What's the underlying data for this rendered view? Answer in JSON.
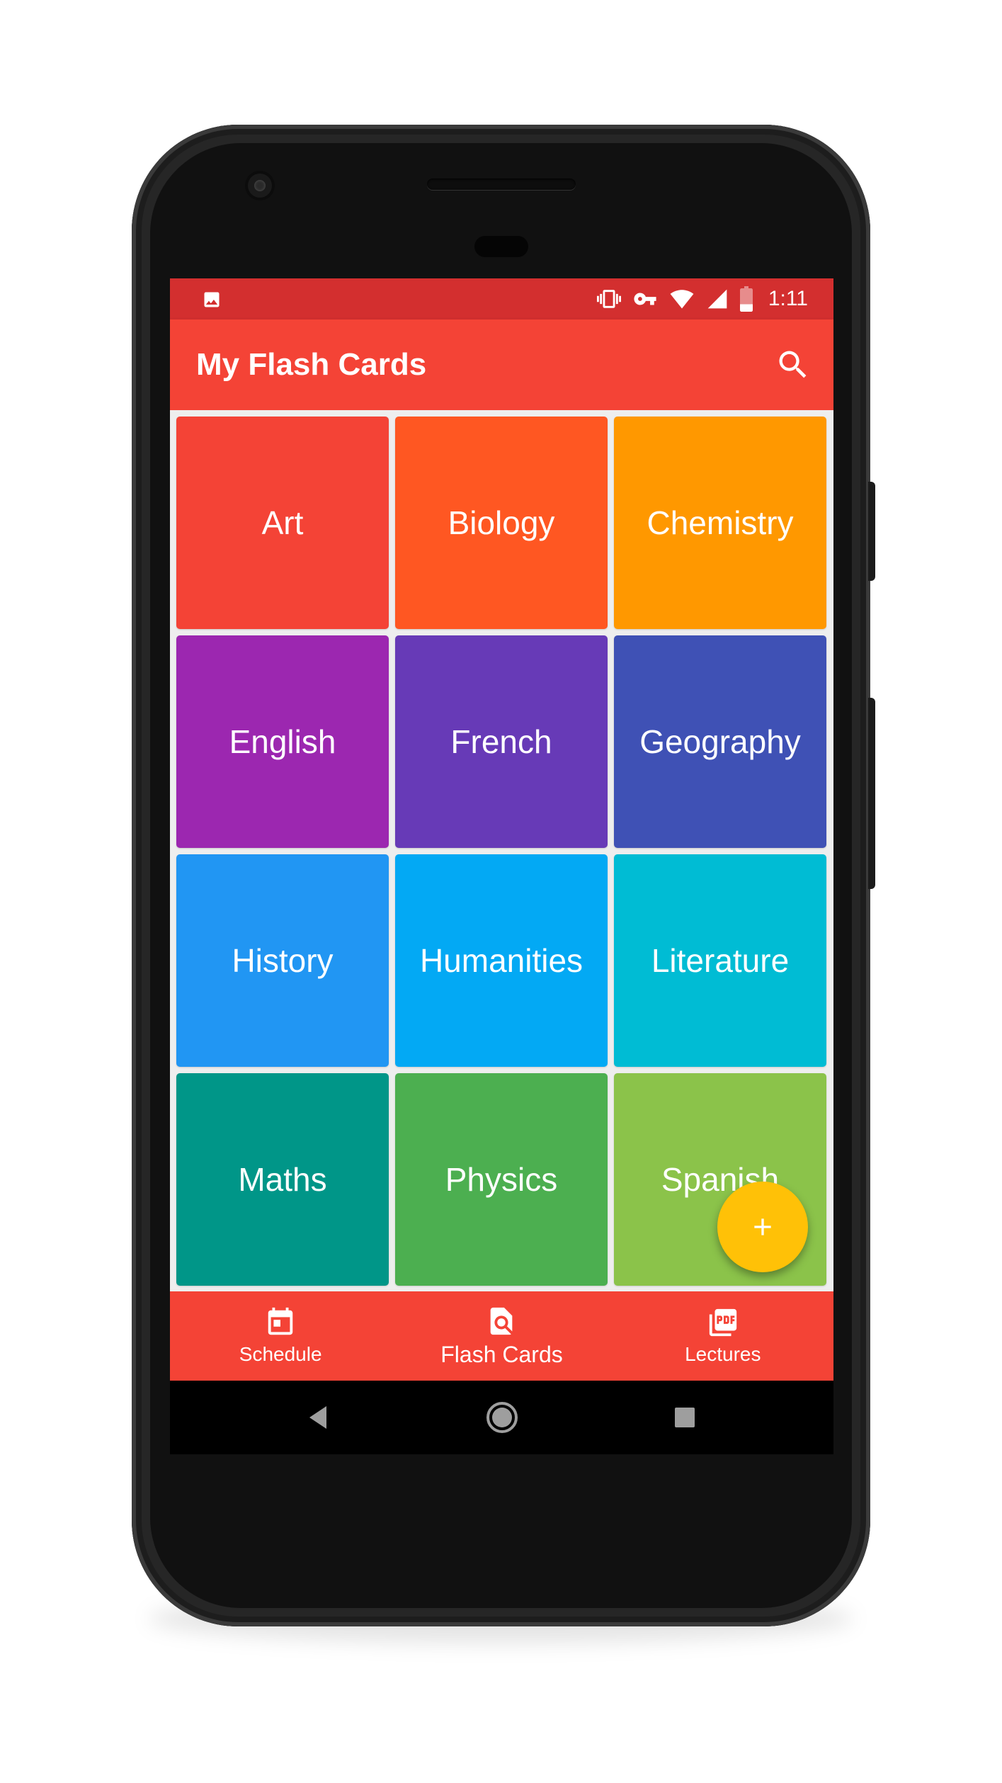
{
  "status_bar": {
    "time": "1:11",
    "icons": [
      "image-icon",
      "vibrate-icon",
      "vpn-key-icon",
      "wifi-icon",
      "signal-icon",
      "battery-icon"
    ]
  },
  "app_bar": {
    "title": "My Flash Cards",
    "search_icon": "search-icon"
  },
  "subjects": [
    {
      "label": "Art",
      "color": "#f44336"
    },
    {
      "label": "Biology",
      "color": "#ff5722"
    },
    {
      "label": "Chemistry",
      "color": "#ff9800"
    },
    {
      "label": "English",
      "color": "#9c27b0"
    },
    {
      "label": "French",
      "color": "#673ab7"
    },
    {
      "label": "Geography",
      "color": "#3f51b5"
    },
    {
      "label": "History",
      "color": "#2196f3"
    },
    {
      "label": "Humanities",
      "color": "#03a9f4"
    },
    {
      "label": "Literature",
      "color": "#00bcd4"
    },
    {
      "label": "Maths",
      "color": "#009688"
    },
    {
      "label": "Physics",
      "color": "#4caf50"
    },
    {
      "label": "Spanish",
      "color": "#8bc34a"
    }
  ],
  "fab": {
    "icon": "plus-icon",
    "color": "#ffc107"
  },
  "bottom_nav": [
    {
      "label": "Schedule",
      "icon": "calendar-icon",
      "active": false
    },
    {
      "label": "Flash Cards",
      "icon": "search-document-icon",
      "active": true
    },
    {
      "label": "Lectures",
      "icon": "pdf-icon",
      "active": false
    }
  ],
  "colors": {
    "status_bar": "#d32f2f",
    "app_bar": "#f44336",
    "background": "#eeeeee"
  }
}
